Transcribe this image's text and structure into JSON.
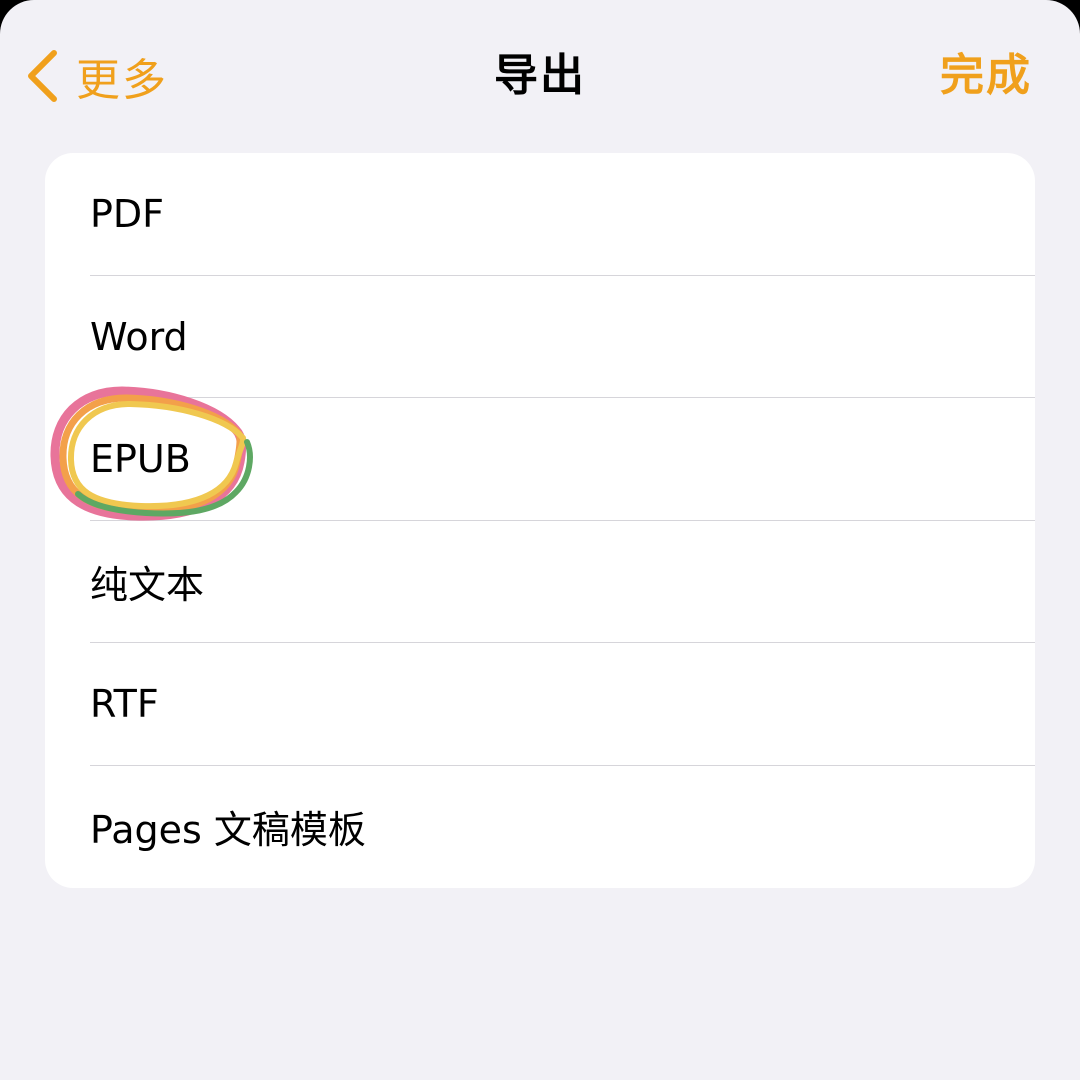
{
  "nav": {
    "back_label": "更多",
    "title": "导出",
    "done_label": "完成"
  },
  "export_options": [
    {
      "label": "PDF"
    },
    {
      "label": "Word"
    },
    {
      "label": "EPUB"
    },
    {
      "label": "纯文本"
    },
    {
      "label": "RTF"
    },
    {
      "label": "Pages 文稿模板"
    }
  ],
  "icons": {
    "back": "chevron-left-icon"
  },
  "highlight": {
    "target": "EPUB",
    "colors": [
      "#e8749a",
      "#f3a04a",
      "#f0c850",
      "#5ea863"
    ]
  },
  "colors": {
    "accent": "#f0a01c",
    "background": "#f2f1f6",
    "card": "#ffffff",
    "separator": "#d6d5da"
  }
}
